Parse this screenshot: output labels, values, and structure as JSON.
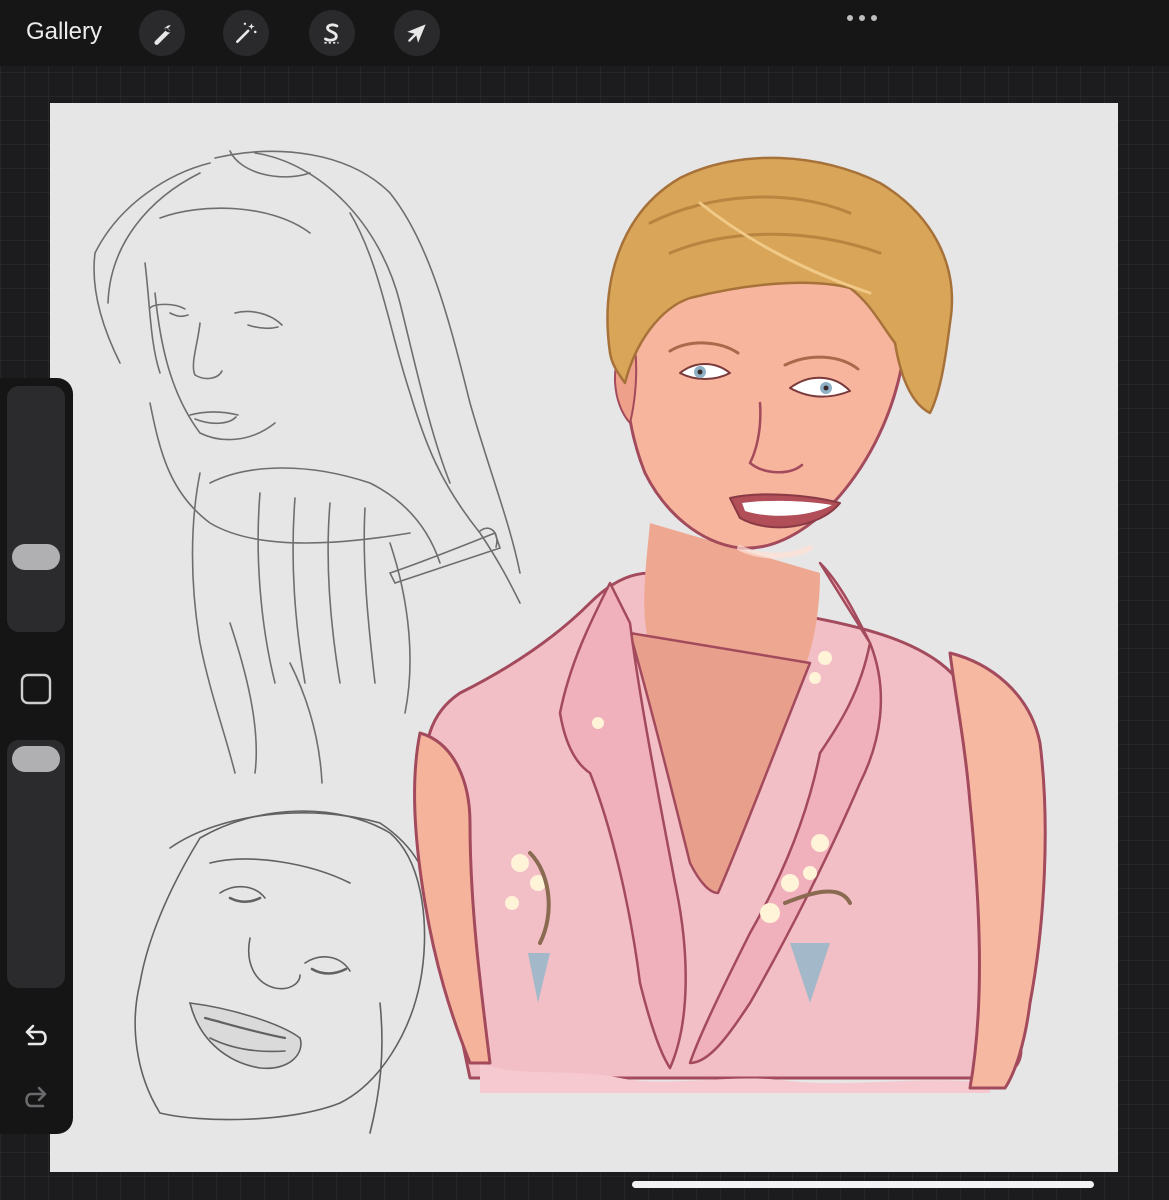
{
  "topbar": {
    "gallery_label": "Gallery",
    "tools": [
      {
        "name": "actions",
        "icon": "wrench-icon"
      },
      {
        "name": "adjustments",
        "icon": "magic-wand-icon"
      },
      {
        "name": "selection",
        "icon": "selection-s-icon"
      },
      {
        "name": "transform",
        "icon": "arrow-cursor-icon"
      }
    ],
    "more_icon": "ellipsis-icon"
  },
  "sidebar": {
    "brush_size_level": 0.7,
    "opacity_level": 0.05,
    "modify_icon": "square-icon",
    "undo_icon": "undo-arrow-icon",
    "redo_icon": "redo-arrow-icon"
  },
  "canvas": {
    "background": "#e6e6e7",
    "artwork": [
      "pencil-sketch-woman-looking-over-shoulder",
      "pencil-sketch-smiling-face",
      "painted-portrait-woman-pink-blouse"
    ]
  },
  "colors": {
    "ui_dark": "#161617",
    "button_bg": "#2a2a2c",
    "icon": "#e8e8e8",
    "skin": "#f1b7a0",
    "hair": "#d8a65c",
    "blouse": "#f2bfc6",
    "outline": "#a34a5c"
  }
}
